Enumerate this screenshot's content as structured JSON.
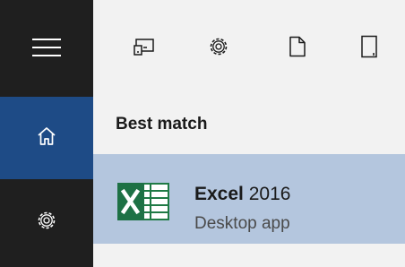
{
  "rail": {
    "items": [
      {
        "icon": "hamburger-menu-icon"
      },
      {
        "icon": "home-icon",
        "selected": true
      },
      {
        "icon": "gear-icon"
      }
    ],
    "selected_color": "#1e4b86"
  },
  "toolbar": {
    "icons": [
      "app-window-icon",
      "gear-icon",
      "document-icon",
      "tablet-icon"
    ]
  },
  "results": {
    "section_title": "Best match",
    "item": {
      "name_bold": "Excel",
      "name_rest": " 2016",
      "subtitle": "Desktop app",
      "icon": "excel-icon",
      "highlight_color": "#b4c6de"
    }
  }
}
